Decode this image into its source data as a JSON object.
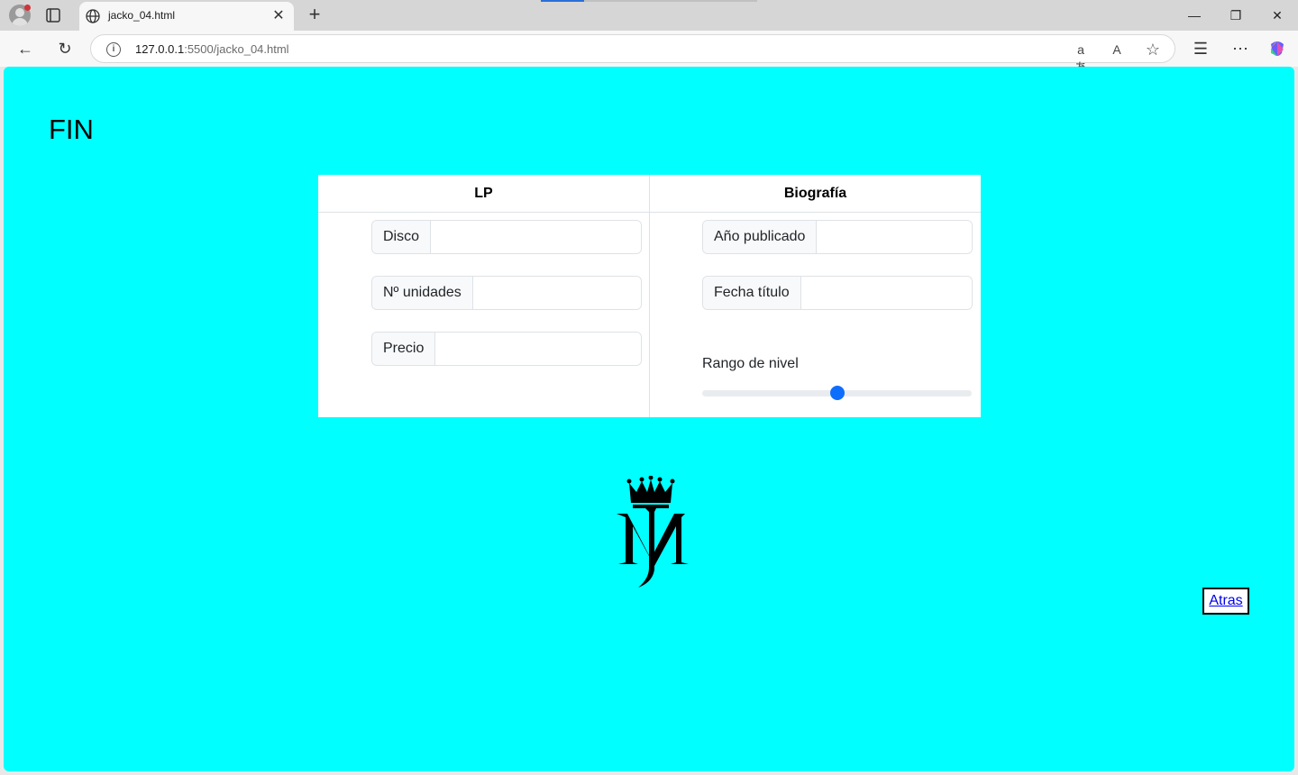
{
  "browser": {
    "tab_title": "jacko_04.html",
    "url_host": "127.0.0.1",
    "url_rest": ":5500/jacko_04.html"
  },
  "page": {
    "title": "FIN",
    "table": {
      "col1_header": "LP",
      "col2_header": "Biografía",
      "disco_label": "Disco",
      "disco_value": "",
      "unidades_label": "Nº unidades",
      "unidades_value": "",
      "precio_label": "Precio",
      "precio_value": "",
      "anio_label": "Año publicado",
      "anio_value": "",
      "fecha_label": "Fecha título",
      "fecha_value": "",
      "range_label": "Rango de nivel",
      "range_value": 50
    },
    "logo_alt": "MJ",
    "back_link": "Atras"
  },
  "colors": {
    "page_background": "#00ffff",
    "slider_accent": "#0d6efd",
    "link": "#0000ee"
  },
  "icons": [
    "globe-icon",
    "close-icon",
    "plus-icon",
    "back-arrow-icon",
    "reload-icon",
    "info-icon",
    "translate-icon",
    "read-aloud-icon",
    "star-icon",
    "favorites-icon",
    "more-icon",
    "copilot-icon"
  ]
}
